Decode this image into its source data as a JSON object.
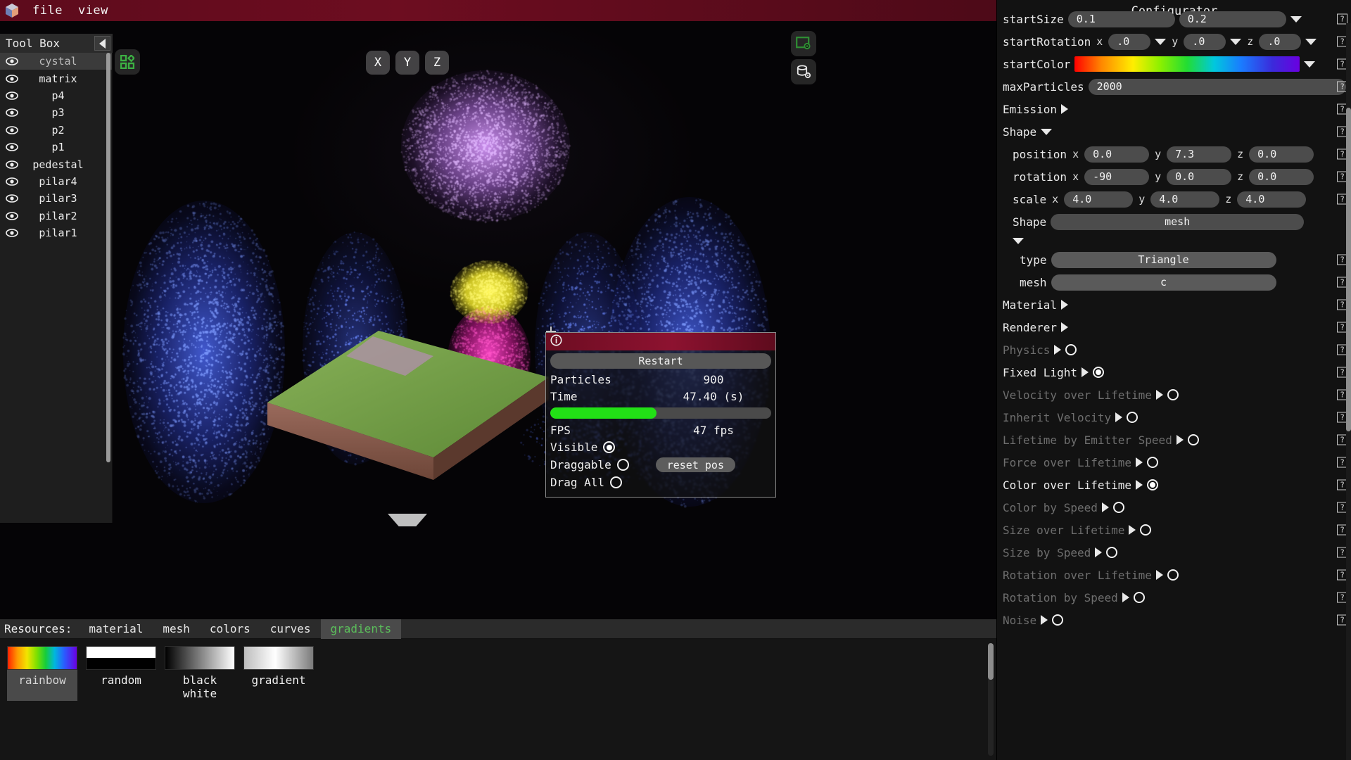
{
  "menubar": {
    "items": [
      "file",
      "view"
    ],
    "logo_icon": "cube-logo-icon"
  },
  "toolbox": {
    "title": "Tool Box",
    "collapse_icon": "collapse-left-icon",
    "items": [
      {
        "label": "pilar1",
        "visible": true,
        "selected": false
      },
      {
        "label": "pilar2",
        "visible": true,
        "selected": false
      },
      {
        "label": "pilar3",
        "visible": true,
        "selected": false
      },
      {
        "label": "pilar4",
        "visible": true,
        "selected": false
      },
      {
        "label": "pedestal",
        "visible": true,
        "selected": false
      },
      {
        "label": "p1",
        "visible": true,
        "selected": false
      },
      {
        "label": "p2",
        "visible": true,
        "selected": false
      },
      {
        "label": "p3",
        "visible": true,
        "selected": false
      },
      {
        "label": "p4",
        "visible": true,
        "selected": false
      },
      {
        "label": "matrix",
        "visible": true,
        "selected": false
      },
      {
        "label": "cystal",
        "visible": true,
        "selected": true
      }
    ]
  },
  "viewport": {
    "axis_buttons": [
      "X",
      "Y",
      "Z"
    ],
    "tool_icons": [
      "grid-tool-icon",
      "screenshot-tool-icon",
      "database-settings-icon"
    ],
    "crosshair_icon": "crosshair-icon",
    "drag_handle_icon": "panel-drag-handle-icon"
  },
  "stats": {
    "title_icon": "info-icon",
    "restart_label": "Restart",
    "rows": [
      {
        "key": "Particles",
        "value": "900"
      },
      {
        "key": "Time",
        "value": "47.40 (s)"
      }
    ],
    "progress_percent": 48,
    "progress_color": "#22e016",
    "fps_key": "FPS",
    "fps_value": "47 fps",
    "toggles": [
      {
        "label": "Visible",
        "on": true
      },
      {
        "label": "Draggable",
        "on": false
      },
      {
        "label": "Drag All",
        "on": false
      }
    ],
    "reset_pos_label": "reset pos"
  },
  "resources": {
    "label": "Resources:",
    "tabs": [
      {
        "label": "material",
        "active": false
      },
      {
        "label": "mesh",
        "active": false
      },
      {
        "label": "colors",
        "active": false
      },
      {
        "label": "curves",
        "active": false
      },
      {
        "label": "gradients",
        "active": true
      }
    ],
    "items": [
      {
        "label": "rainbow",
        "kind": "rainbow",
        "selected": true
      },
      {
        "label": "random",
        "kind": "random",
        "selected": false
      },
      {
        "label": "black white",
        "kind": "blackwhite",
        "selected": false
      },
      {
        "label": "gradient",
        "kind": "gradient",
        "selected": false
      }
    ]
  },
  "configurator": {
    "title": "Configurator",
    "help_glyph": "?",
    "start_size": {
      "label": "startSize",
      "min": "0.1",
      "max": "0.2"
    },
    "start_rotation": {
      "label": "startRotation",
      "x": ".0",
      "y": ".0",
      "z": ".0"
    },
    "start_color": {
      "label": "startColor"
    },
    "max_particles": {
      "label": "maxParticles",
      "value": "2000"
    },
    "emission": {
      "label": "Emission",
      "expanded": false
    },
    "shape": {
      "label": "Shape",
      "expanded": true,
      "position": {
        "label": "position",
        "x": "0.0",
        "y": "7.3",
        "z": "0.0"
      },
      "rotation": {
        "label": "rotation",
        "x": "-90",
        "y": "0.0",
        "z": "0.0"
      },
      "scale": {
        "label": "scale",
        "x": "4.0",
        "y": "4.0",
        "z": "4.0"
      },
      "shape_field": {
        "label": "Shape",
        "value": "mesh"
      },
      "type": {
        "label": "type",
        "value": "Triangle"
      },
      "mesh": {
        "label": "mesh",
        "value": "c"
      }
    },
    "modules": [
      {
        "label": "Material",
        "has_toggle": false,
        "enabled": true
      },
      {
        "label": "Renderer",
        "has_toggle": false,
        "enabled": true
      },
      {
        "label": "Physics",
        "has_toggle": true,
        "on": false,
        "enabled": false
      },
      {
        "label": "Fixed Light",
        "has_toggle": true,
        "on": true,
        "enabled": true
      },
      {
        "label": "Velocity over Lifetime",
        "has_toggle": true,
        "on": false,
        "enabled": false
      },
      {
        "label": "Inherit Velocity",
        "has_toggle": true,
        "on": false,
        "enabled": false
      },
      {
        "label": "Lifetime by Emitter Speed",
        "has_toggle": true,
        "on": false,
        "enabled": false
      },
      {
        "label": "Force over Lifetime",
        "has_toggle": true,
        "on": false,
        "enabled": false
      },
      {
        "label": "Color over Lifetime",
        "has_toggle": true,
        "on": true,
        "enabled": true
      },
      {
        "label": "Color by Speed",
        "has_toggle": true,
        "on": false,
        "enabled": false
      },
      {
        "label": "Size over Lifetime",
        "has_toggle": true,
        "on": false,
        "enabled": false
      },
      {
        "label": "Size by Speed",
        "has_toggle": true,
        "on": false,
        "enabled": false
      },
      {
        "label": "Rotation over Lifetime",
        "has_toggle": true,
        "on": false,
        "enabled": false
      },
      {
        "label": "Rotation by Speed",
        "has_toggle": true,
        "on": false,
        "enabled": false
      },
      {
        "label": "Noise",
        "has_toggle": true,
        "on": false,
        "enabled": false
      }
    ]
  }
}
